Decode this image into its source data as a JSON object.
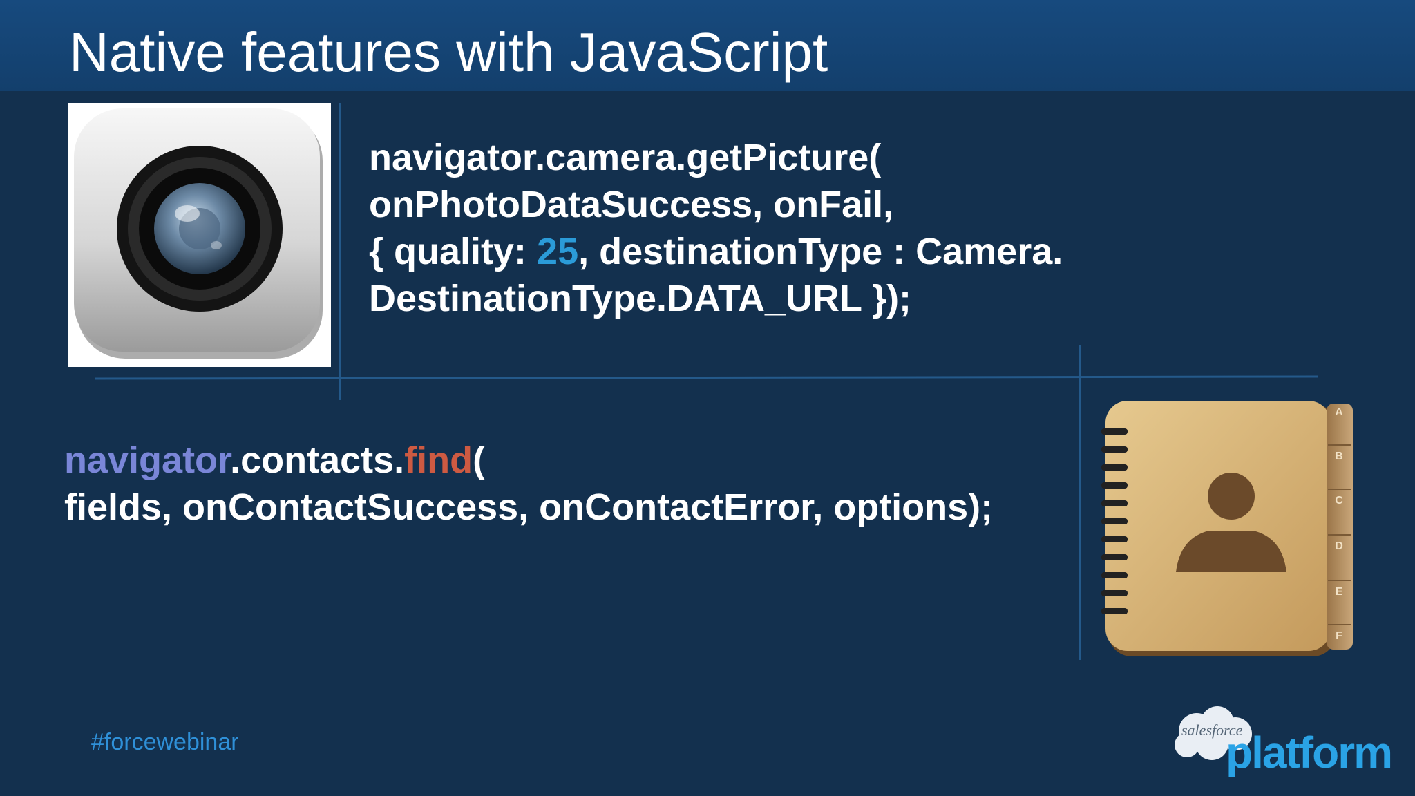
{
  "slide": {
    "title": "Native features with JavaScript"
  },
  "camera": {
    "icon": "camera-icon",
    "code": {
      "line1": "navigator.camera.getPicture(",
      "line2": "onPhotoDataSuccess, onFail,",
      "line3_pre": "{ quality: ",
      "line3_num": "25",
      "line3_post": ", destinationType : Camera.",
      "line4": "DestinationType.DATA_URL });"
    }
  },
  "contacts": {
    "icon": "address-book-icon",
    "tabs": [
      "A",
      "B",
      "C",
      "D",
      "E",
      "F"
    ],
    "code": {
      "ns": "navigator",
      "mid": ".contacts.",
      "fn": "find",
      "open": "(",
      "line2": "fields, onContactSuccess, onContactError, options);"
    }
  },
  "footer": {
    "hashtag": "#forcewebinar",
    "logo_small": "salesforce",
    "logo_large": "platform"
  },
  "colors": {
    "background": "#13304e",
    "title_bar": "#174a7e",
    "number": "#2b9bd8",
    "namespace": "#7a86d8",
    "function": "#cd5a42",
    "hashtag": "#2f90d8"
  }
}
